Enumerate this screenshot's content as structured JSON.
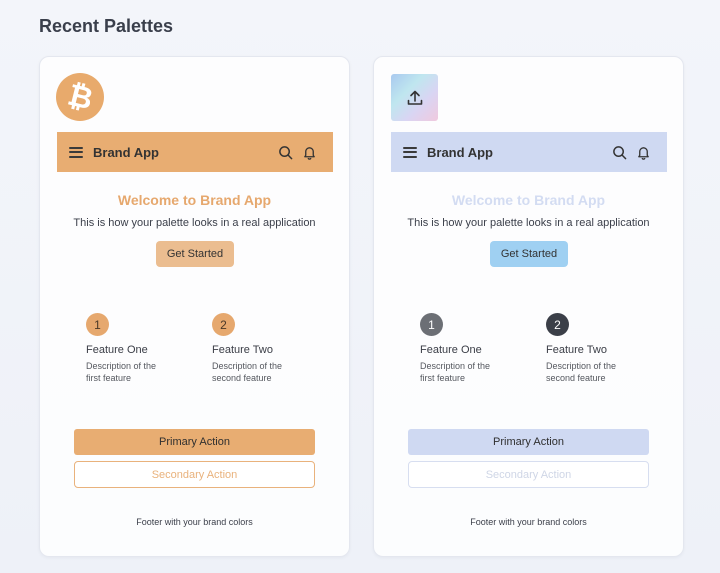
{
  "page_title": "Recent Palettes",
  "cards": [
    {
      "logo_icon": "bitcoin-icon",
      "app_name": "Brand App",
      "welcome": "Welcome to Brand App",
      "subtitle": "This is how your palette looks in a real application",
      "cta_label": "Get Started",
      "features": [
        {
          "number": "1",
          "title": "Feature One",
          "desc_line1": "Description of the",
          "desc_line2": "first feature"
        },
        {
          "number": "2",
          "title": "Feature Two",
          "desc_line1": "Description of the",
          "desc_line2": "second feature"
        }
      ],
      "primary_label": "Primary Action",
      "secondary_label": "Secondary Action",
      "footer": "Footer with your brand colors",
      "colors": {
        "primary": "#e8ad72",
        "accent": "#e6a86e",
        "cta": "#ebbd90"
      }
    },
    {
      "logo_icon": "upload-icon",
      "app_name": "Brand App",
      "welcome": "Welcome to Brand App",
      "subtitle": "This is how your palette looks in a real application",
      "cta_label": "Get Started",
      "features": [
        {
          "number": "1",
          "title": "Feature One",
          "desc_line1": "Description of the",
          "desc_line2": "first feature"
        },
        {
          "number": "2",
          "title": "Feature Two",
          "desc_line1": "Description of the",
          "desc_line2": "second feature"
        }
      ],
      "primary_label": "Primary Action",
      "secondary_label": "Secondary Action",
      "footer": "Footer with your brand colors",
      "colors": {
        "primary": "#cfd9f2",
        "accent": "#d3dcf2",
        "cta": "#9fd0f2"
      }
    }
  ]
}
